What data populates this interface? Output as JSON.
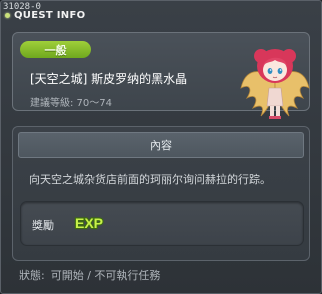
{
  "window": {
    "quest_id": "31028-0",
    "title": "QUEST INFO"
  },
  "header": {
    "category": "一般",
    "quest_name": "[天空之城] 斯皮罗纳的黑水晶",
    "required_level": "建議等級: 70～74"
  },
  "content": {
    "section_title": "內容",
    "description": "向天空之城杂货店前面的珂丽尔询问赫拉的行踪。",
    "reward_label": "獎勵",
    "reward_type": "EXP"
  },
  "status": {
    "label": "狀態:",
    "value": "可開始 / 不可執行任務"
  },
  "colors": {
    "category_badge": "#86bd2c",
    "exp_text": "#c8f24a",
    "background": "#2d3237"
  }
}
